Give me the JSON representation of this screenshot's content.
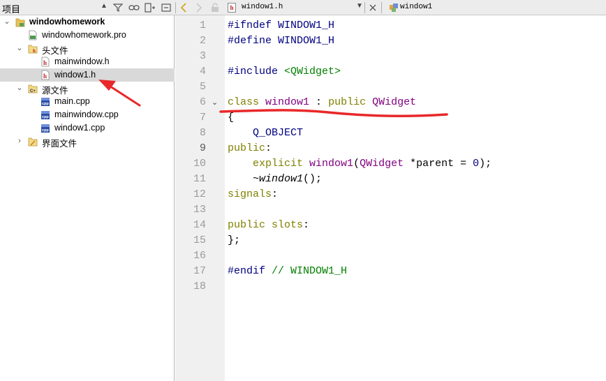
{
  "toolbar": {
    "project_title": "项目",
    "file_tab_name": "window1.h",
    "symbol_tab_name": "window1"
  },
  "project_tree": [
    {
      "label": "windowhomework",
      "depth": 0,
      "expanded": true,
      "bold": true,
      "icon": "project-folder-icon",
      "selected": false
    },
    {
      "label": "windowhomework.pro",
      "depth": 1,
      "icon": "pro-file-icon",
      "selected": false
    },
    {
      "label": "头文件",
      "depth": 1,
      "expanded": true,
      "icon": "headers-folder-icon",
      "selected": false
    },
    {
      "label": "mainwindow.h",
      "depth": 2,
      "icon": "header-file-icon",
      "selected": false
    },
    {
      "label": "window1.h",
      "depth": 2,
      "icon": "header-file-icon",
      "selected": true
    },
    {
      "label": "源文件",
      "depth": 1,
      "expanded": true,
      "icon": "sources-folder-icon",
      "selected": false
    },
    {
      "label": "main.cpp",
      "depth": 2,
      "icon": "cpp-file-icon",
      "selected": false
    },
    {
      "label": "mainwindow.cpp",
      "depth": 2,
      "icon": "cpp-file-icon",
      "selected": false
    },
    {
      "label": "window1.cpp",
      "depth": 2,
      "icon": "cpp-file-icon",
      "selected": false
    },
    {
      "label": "界面文件",
      "depth": 1,
      "expanded": false,
      "icon": "forms-folder-icon",
      "selected": false
    }
  ],
  "editor": {
    "current_line": 9,
    "fold_marker_line": 6,
    "lines": [
      {
        "n": "1",
        "tokens": [
          {
            "t": "#ifndef WINDOW1_H",
            "c": "c-pp"
          }
        ]
      },
      {
        "n": "2",
        "tokens": [
          {
            "t": "#define WINDOW1_H",
            "c": "c-pp"
          }
        ]
      },
      {
        "n": "3",
        "tokens": []
      },
      {
        "n": "4",
        "tokens": [
          {
            "t": "#include ",
            "c": "c-pp"
          },
          {
            "t": "<QWidget>",
            "c": "c-inc"
          }
        ]
      },
      {
        "n": "5",
        "tokens": []
      },
      {
        "n": "6",
        "tokens": [
          {
            "t": "class",
            "c": "c-kw"
          },
          {
            "t": " ",
            "c": ""
          },
          {
            "t": "window1",
            "c": "c-type"
          },
          {
            "t": " : ",
            "c": ""
          },
          {
            "t": "public",
            "c": "c-kw"
          },
          {
            "t": " ",
            "c": ""
          },
          {
            "t": "QWidget",
            "c": "c-type"
          }
        ]
      },
      {
        "n": "7",
        "tokens": [
          {
            "t": "{",
            "c": ""
          }
        ]
      },
      {
        "n": "8",
        "tokens": [
          {
            "t": "    ",
            "c": ""
          },
          {
            "t": "Q_OBJECT",
            "c": "c-pp"
          }
        ]
      },
      {
        "n": "9",
        "tokens": [
          {
            "t": "public",
            "c": "c-kw"
          },
          {
            "t": ":",
            "c": ""
          }
        ]
      },
      {
        "n": "10",
        "tokens": [
          {
            "t": "    ",
            "c": ""
          },
          {
            "t": "explicit",
            "c": "c-kw"
          },
          {
            "t": " ",
            "c": ""
          },
          {
            "t": "window1",
            "c": "c-type"
          },
          {
            "t": "(",
            "c": ""
          },
          {
            "t": "QWidget",
            "c": "c-type"
          },
          {
            "t": " *parent = ",
            "c": ""
          },
          {
            "t": "0",
            "c": "c-num"
          },
          {
            "t": ");",
            "c": ""
          }
        ]
      },
      {
        "n": "11",
        "tokens": [
          {
            "t": "    ~",
            "c": ""
          },
          {
            "t": "window1",
            "c": "c-ital"
          },
          {
            "t": "();",
            "c": ""
          }
        ]
      },
      {
        "n": "12",
        "tokens": [
          {
            "t": "signals",
            "c": "c-kw"
          },
          {
            "t": ":",
            "c": ""
          }
        ]
      },
      {
        "n": "13",
        "tokens": []
      },
      {
        "n": "14",
        "tokens": [
          {
            "t": "public",
            "c": "c-kw"
          },
          {
            "t": " ",
            "c": ""
          },
          {
            "t": "slots",
            "c": "c-kw"
          },
          {
            "t": ":",
            "c": ""
          }
        ]
      },
      {
        "n": "15",
        "tokens": [
          {
            "t": "};",
            "c": ""
          }
        ]
      },
      {
        "n": "16",
        "tokens": []
      },
      {
        "n": "17",
        "tokens": [
          {
            "t": "#endif",
            "c": "c-pp"
          },
          {
            "t": " // WINDOW1_H",
            "c": "c-com"
          }
        ]
      },
      {
        "n": "18",
        "tokens": []
      }
    ]
  },
  "annotation_color": "#e8282a"
}
